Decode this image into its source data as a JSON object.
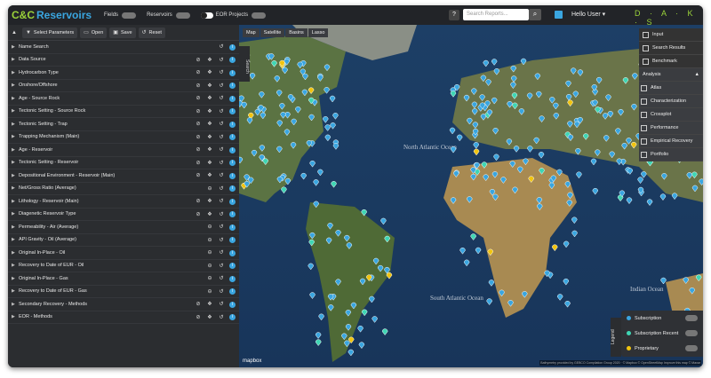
{
  "app": {
    "logo_a": "C&C",
    "logo_b": "Reservoirs"
  },
  "topbar": {
    "toggles": [
      {
        "label": "Fields"
      },
      {
        "label": "Reservoirs"
      }
    ],
    "eor_label": "EOR Projects",
    "help": "?",
    "search_placeholder": "Search Reports...",
    "user": "Hello User",
    "brand": "D · A · K · S"
  },
  "panel": {
    "toolbar": {
      "select": "Select Parameters",
      "open": "Open",
      "save": "Save",
      "reset": "Reset"
    },
    "rows": [
      {
        "label": "Name Search",
        "icons": "ri"
      },
      {
        "label": "Data Source",
        "icons": "svri"
      },
      {
        "label": "Hydrocarbon Type",
        "icons": "svri"
      },
      {
        "label": "Onshore/Offshore",
        "icons": "svri"
      },
      {
        "label": "Age - Source Rock",
        "icons": "svri"
      },
      {
        "label": "Tectonic Setting - Source Rock",
        "icons": "svri"
      },
      {
        "label": "Tectonic Setting - Trap",
        "icons": "svri"
      },
      {
        "label": "Trapping Mechanism (Main)",
        "icons": "svri"
      },
      {
        "label": "Age - Reservoir",
        "icons": "svri"
      },
      {
        "label": "Tectonic Setting - Reservoir",
        "icons": "svri"
      },
      {
        "label": "Depositional Environment - Reservoir (Main)",
        "icons": "svri"
      },
      {
        "label": "Net/Gross Ratio (Average)",
        "icons": "mri"
      },
      {
        "label": "Lithology - Reservoir (Main)",
        "icons": "svri"
      },
      {
        "label": "Diagenetic Reservoir Type",
        "icons": "svri"
      },
      {
        "label": "Permeability - Air (Average)",
        "icons": "mri"
      },
      {
        "label": "API Gravity - Oil (Average)",
        "icons": "mri"
      },
      {
        "label": "Original In-Place - Oil",
        "icons": "mri"
      },
      {
        "label": "Recovery to Date of EUR - Oil",
        "icons": "mri"
      },
      {
        "label": "Original In-Place - Gas",
        "icons": "mri"
      },
      {
        "label": "Recovery to Date of EUR - Gas",
        "icons": "mri"
      },
      {
        "label": "Secondary Recovery - Methods",
        "icons": "svri"
      },
      {
        "label": "EOR - Methods",
        "icons": "svri"
      }
    ]
  },
  "map": {
    "buttons": [
      "Map",
      "Satellite",
      "Basins",
      "Lasso"
    ],
    "search_tab": "Search",
    "ocean_labels": [
      "North Atlantic Ocean",
      "South Atlantic Ocean",
      "Indian Ocean"
    ],
    "right_menu": {
      "items": [
        "Input",
        "Search Results",
        "Benchmark"
      ],
      "analysis": "Analysis",
      "sub_items": [
        "Atlas",
        "Characterization",
        "Crossplot",
        "Performance",
        "Empirical Recovery",
        "Portfolio"
      ]
    },
    "legend": {
      "tab": "Legend",
      "items": [
        {
          "label": "Subscription",
          "color": "#3aa6e0"
        },
        {
          "label": "Subscription Recent",
          "color": "#3fd6b4"
        },
        {
          "label": "Proprietary",
          "color": "#f1c40f"
        }
      ]
    },
    "mapbox_logo": "mapbox",
    "attribution": "Bathymetry provided by GEBCO Compilation Group 2020 · © Mapbox © OpenStreetMap Improve this map © Maxar"
  }
}
